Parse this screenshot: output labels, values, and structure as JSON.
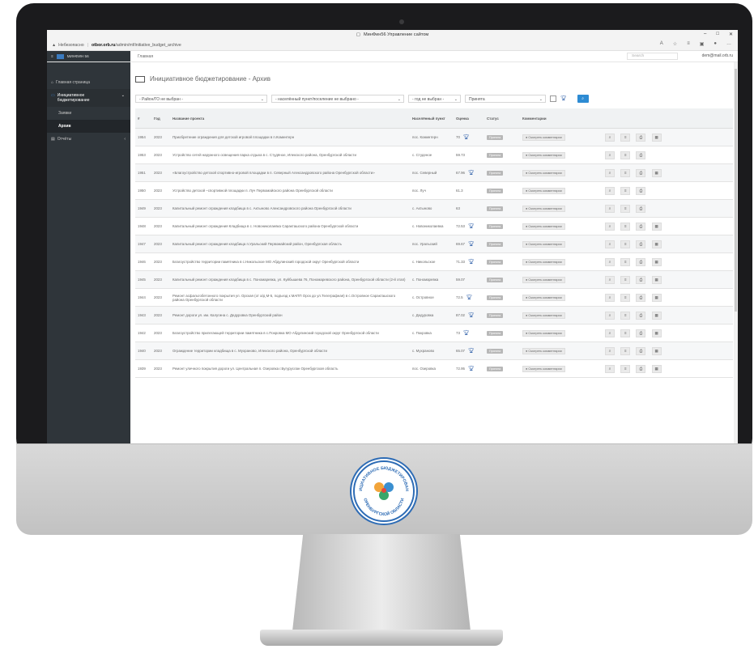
{
  "browser": {
    "tab_title": "МинФин56 Управление сайтом",
    "security_label": "Небезопасно",
    "url_domain": "otbor.orb.ru",
    "url_path": "/admin/mf/initiative_budget_archive"
  },
  "app": {
    "brand": "МИНФИН 56",
    "breadcrumb": "Главная",
    "search_placeholder": "Search",
    "user_email": "dem@mail.orb.ru"
  },
  "sidebar": {
    "home": "Главная страница",
    "group": "Инициативное бюджетирование",
    "sub_requests": "Заявки",
    "sub_archive": "Архив",
    "reports": "Отчёты"
  },
  "page": {
    "title": "Инициативное бюджетирование - Архив"
  },
  "filters": {
    "district": "- Район/ГО не выбран -",
    "settlement": "- населённый пункт/поселение не выбрано -",
    "year": "- год не выбран -",
    "status": "Принята"
  },
  "table": {
    "headers": {
      "num": "#",
      "year": "Год",
      "name": "Название проекта",
      "place": "Населённый пункт",
      "score": "Оценка",
      "status": "Статус",
      "comments": "Комментарии"
    },
    "status_badge": "Принята",
    "comment_button": "Смотреть комментарии",
    "rows": [
      {
        "num": "1954",
        "year": "2023",
        "name": "Приобретение ограждения для детской игровой площадки в п.Коминтерн",
        "place": "пос. Коминтерн",
        "score": "70"
      },
      {
        "num": "1953",
        "year": "2023",
        "name": "Устройство сетей наружного освещения парка отдыха в с. Студёное, Илекского района, Оренбургской области",
        "place": "с. Студеное",
        "score": "59.73"
      },
      {
        "num": "1951",
        "year": "2023",
        "name": "«Благоустройство детской спортивно-игровой площадки в п. Северный Александровского района Оренбургской области»",
        "place": "пос. Северный",
        "score": "67.96"
      },
      {
        "num": "1950",
        "year": "2023",
        "name": "Устройство детской –спортивной площадки п. Луч Первомайского района Оренбургской области",
        "place": "пос. Луч",
        "score": "61.3"
      },
      {
        "num": "1949",
        "year": "2023",
        "name": "Капитальный ремонт ограждения кладбища в с. Актыново Александровского района Оренбургской области",
        "place": "с. Актыново",
        "score": "63"
      },
      {
        "num": "1948",
        "year": "2023",
        "name": "Капитальный ремонт ограждения Кладбища в с. Новониколаевка Саракташского района Оренбургской области",
        "place": "с. Новониколаевка",
        "score": "72.53"
      },
      {
        "num": "1947",
        "year": "2023",
        "name": "Капитальный ремонт ограждения кладбища п.Уральский Первомайский район, Оренбургская область",
        "place": "пос. Уральский",
        "score": "69.67"
      },
      {
        "num": "1946",
        "year": "2023",
        "name": "Благоустройство территории памятника в с.Никольское МО Абдулинский городской округ Оренбургской области",
        "place": "с. Никольское",
        "score": "71.33"
      },
      {
        "num": "1945",
        "year": "2023",
        "name": "Капитальный ремонт ограждения кладбища в с. Пономаревка, ул. Куйбышева 76, Пономаревского района, Оренбургской области (2-й этап)",
        "place": "с. Пономаревка",
        "score": "59.07"
      },
      {
        "num": "1944",
        "year": "2023",
        "name": "Ремонт асфальтобетонного покрытия ул. Орская (от а/д М-5, подъезд к МАПП Орск до ул.Телеграфная) в с.Островное Саракташского района Оренбургской области",
        "place": "с. Островное",
        "score": "72.5"
      },
      {
        "num": "1943",
        "year": "2023",
        "name": "Ремонт дороги ул. им. Калугина с. Дедуровка Оренбургский район",
        "place": "с. Дедуровка",
        "score": "87.02"
      },
      {
        "num": "1942",
        "year": "2023",
        "name": "Благоустройство прилегающей территории памятника в с.Покровка МО Абдулинский городской округ Оренбургской области",
        "place": "с. Покровка",
        "score": "73"
      },
      {
        "num": "1940",
        "year": "2023",
        "name": "Ограждение территории кладбища в с. Мухраново, Илекского района, Оренбургской области",
        "place": "с. Мухраново",
        "score": "65.07"
      },
      {
        "num": "1939",
        "year": "2023",
        "name": "Ремонт уличного покрытия дороги ул. Центральная п. Озеровка г.Бугуруслан Оренбургская область",
        "place": "пос. Озеровка",
        "score": "72.95"
      }
    ]
  },
  "logo": {
    "top_text": "ИНИЦИАТИВНОЕ БЮДЖЕТИРОВАНИЕ",
    "bottom_text": "ОРЕНБУРГСКОЙ ОБЛАСТИ"
  },
  "colors": {
    "accent": "#2d8bd3",
    "sidebar": "#2f353a",
    "badge": "#b8b8b8",
    "trophy": "#2d5ea8"
  }
}
